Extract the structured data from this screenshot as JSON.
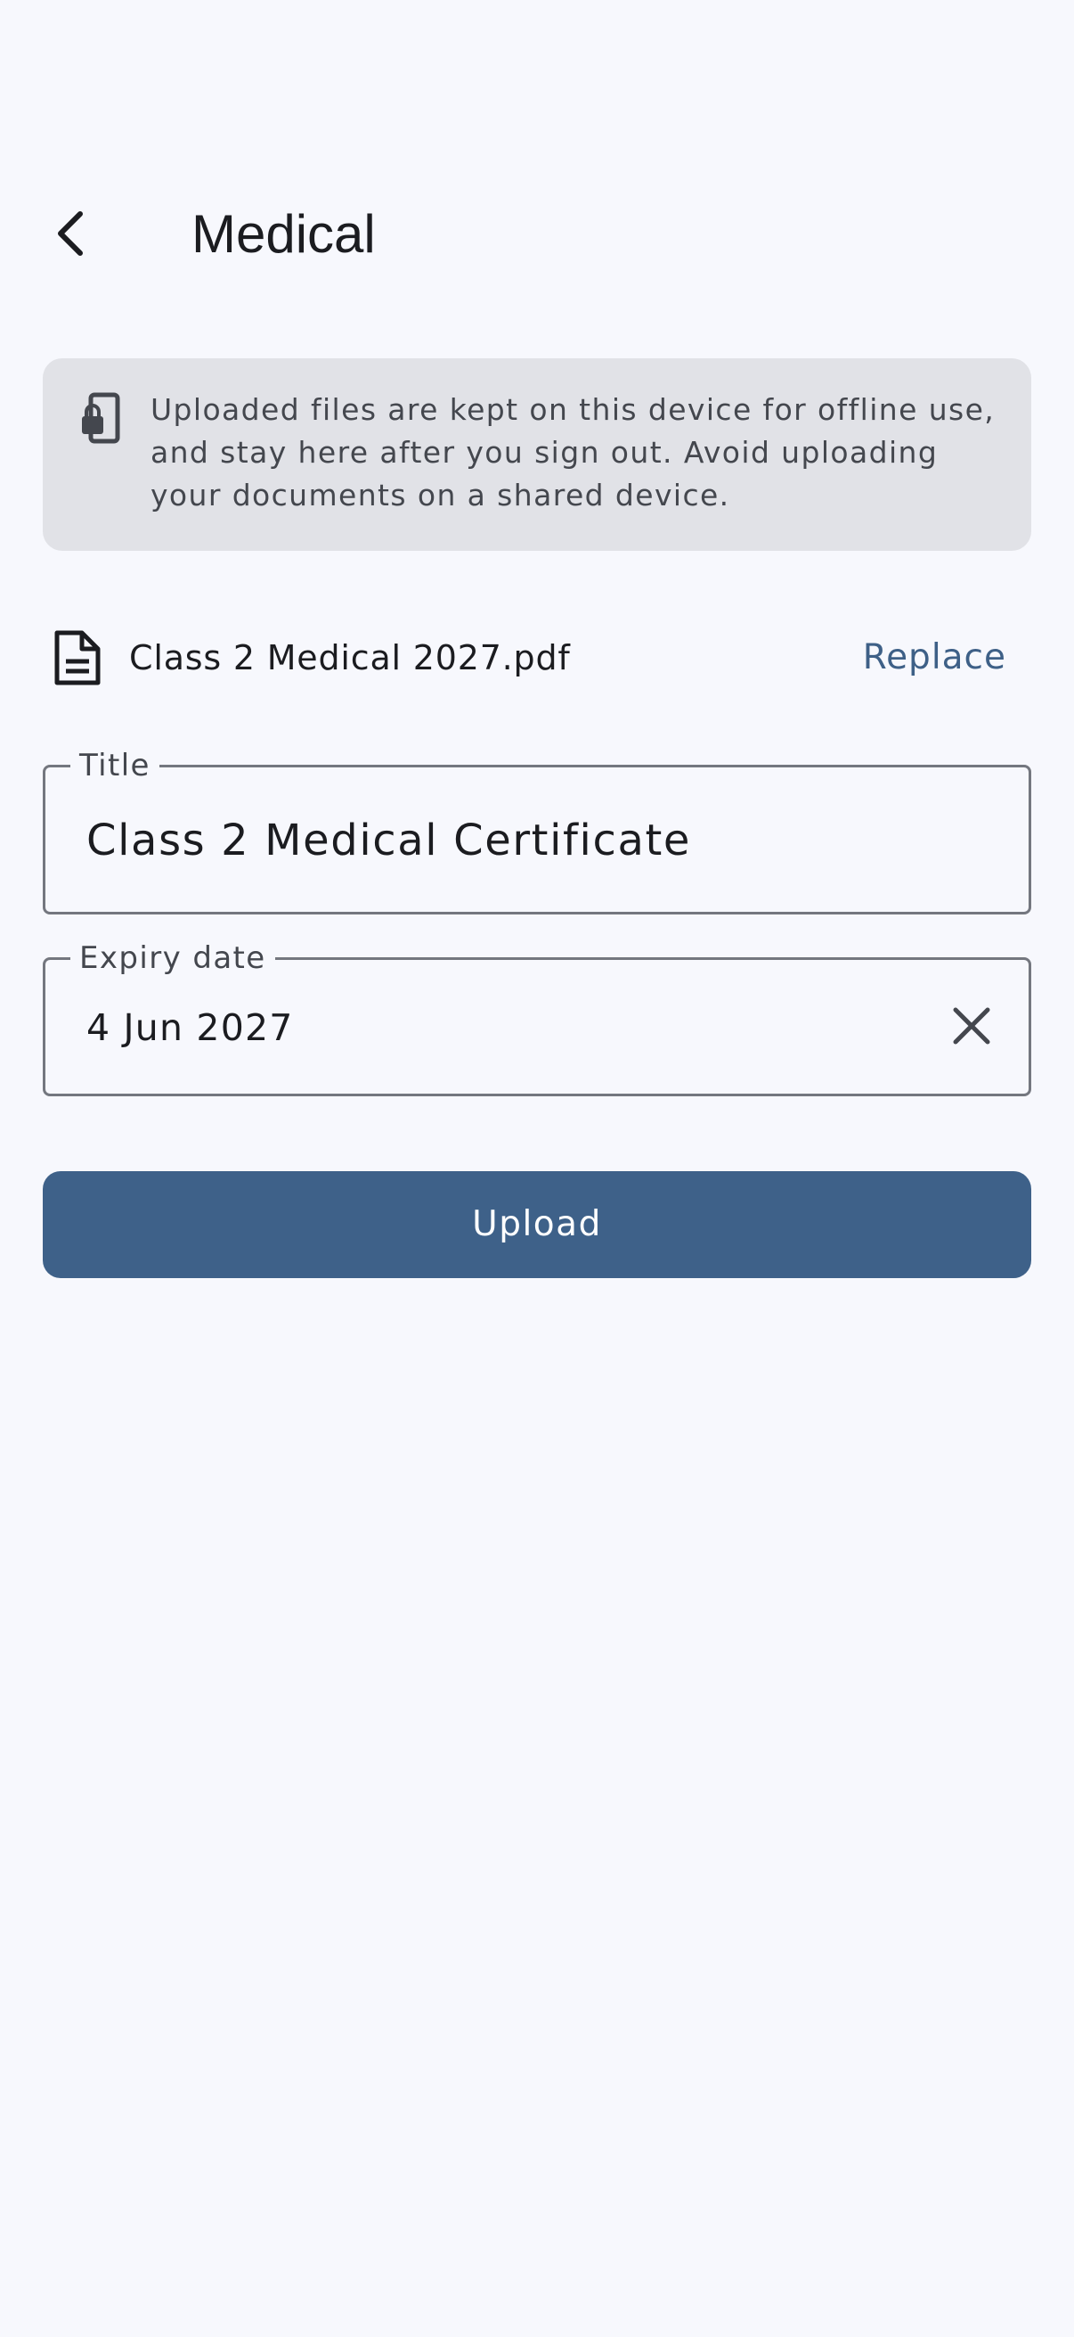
{
  "header": {
    "title": "Medical",
    "back_icon": "chevron-left-icon"
  },
  "notice": {
    "icon": "locked-device-icon",
    "text": "Uploaded files are kept on this device for offline use, and stay here after you sign out. Avoid uploading your documents on a shared device."
  },
  "file": {
    "icon": "document-icon",
    "name": "Class 2 Medical 2027.pdf",
    "replace_label": "Replace"
  },
  "title_field": {
    "label": "Title",
    "value": "Class 2 Medical Certificate"
  },
  "expiry_field": {
    "label": "Expiry date",
    "value": "4 Jun 2027",
    "clear_icon": "close-icon"
  },
  "upload": {
    "label": "Upload"
  },
  "colors": {
    "background": "#f7f8fd",
    "notice_background": "#e1e2e7",
    "accent": "#3e6189",
    "link": "#3e6087",
    "outline": "#74777f",
    "text": "#1b1c20",
    "secondary_text": "#44474e"
  }
}
